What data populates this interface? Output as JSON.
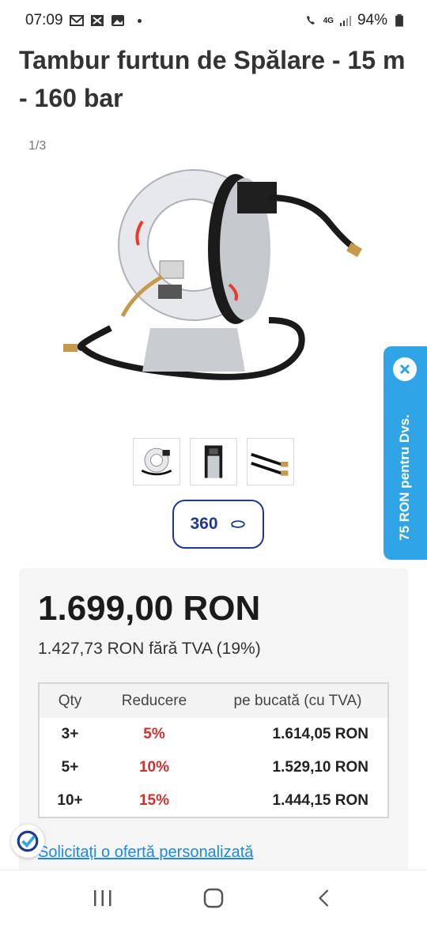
{
  "status_bar": {
    "time": "07:09",
    "battery": "94%",
    "network": "4G"
  },
  "product": {
    "title": "Tambur furtun de Spălare - 15 m - 160 bar",
    "image_counter": "1/3",
    "thumbnails": [
      {
        "name": "hose-reel-front"
      },
      {
        "name": "hose-reel-side"
      },
      {
        "name": "hose-fittings"
      }
    ],
    "view360_label": "360"
  },
  "promo": {
    "text": "75 RON pentru Dvs."
  },
  "pricing": {
    "price": "1.699,00 RON",
    "price_net": "1.427,73 RON fără TVA (19%)",
    "table": {
      "headers": [
        "Qty",
        "Reducere",
        "pe bucată (cu TVA)"
      ],
      "rows": [
        {
          "qty": "3+",
          "discount": "5%",
          "unit_price": "1.614,05 RON"
        },
        {
          "qty": "5+",
          "discount": "10%",
          "unit_price": "1.529,10 RON"
        },
        {
          "qty": "10+",
          "discount": "15%",
          "unit_price": "1.444,15 RON"
        }
      ]
    },
    "offer_link": "Solicitați o ofertă personalizată"
  },
  "colors": {
    "accent_blue": "#1e3a8a",
    "promo_blue": "#2fa4e7",
    "discount_red": "#d32f2f",
    "link_blue": "#1e88e5"
  }
}
